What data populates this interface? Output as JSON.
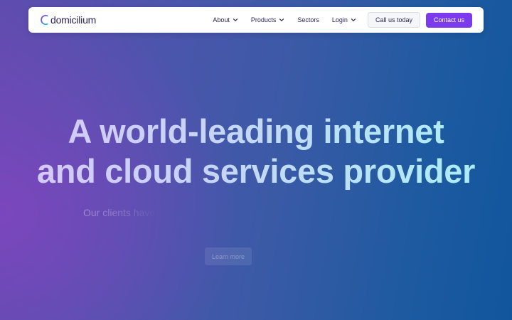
{
  "nav": {
    "brand": "domicilium",
    "brand_icon": "domicilium-logo-icon",
    "items": [
      {
        "label": "About",
        "has_dropdown": true
      },
      {
        "label": "Products",
        "has_dropdown": true
      },
      {
        "label": "Sectors",
        "has_dropdown": false
      },
      {
        "label": "Login",
        "has_dropdown": true
      }
    ],
    "call_label": "Call us today",
    "contact_label": "Contact us"
  },
  "hero": {
    "title_line1": "A world-leading internet",
    "title_line2": "and cloud services provider",
    "subtitle": "Our clients have",
    "cta_label": "Learn more"
  },
  "colors": {
    "accent": "#7c3aed",
    "nav_text": "#2c2459",
    "background_left": "#7d46be",
    "background_right": "#11569d",
    "title_gradient_start": "#d6c8f7",
    "title_gradient_end": "#a8f0f4"
  }
}
